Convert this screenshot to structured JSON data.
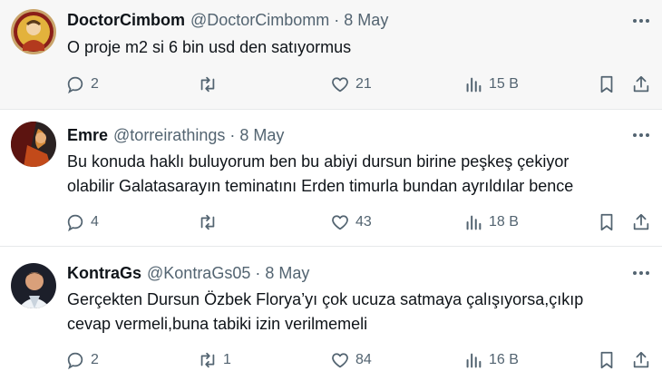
{
  "tweets": [
    {
      "name": "DoctorCimbom",
      "handle": "@DoctorCimbomm",
      "separator": "·",
      "date": "8 May",
      "text_lines": [
        "O proje m2 si 6 bin usd den satıyormus"
      ],
      "replies": "2",
      "retweets": "",
      "likes": "21",
      "views": "15 B"
    },
    {
      "name": "Emre",
      "handle": "@torreirathings",
      "separator": "·",
      "date": "8 May",
      "text_lines": [
        "Bu konuda haklı buluyorum ben bu abiyi dursun birine peşkeş çekiyor",
        "olabilir Galatasarayın teminatını Erden timurla bundan ayrıldılar bence"
      ],
      "replies": "4",
      "retweets": "",
      "likes": "43",
      "views": "18 B"
    },
    {
      "name": "KontraGs",
      "handle": "@KontraGs05",
      "separator": "·",
      "date": "8 May",
      "text_lines": [
        "Gerçekten Dursun Özbek Florya’yı çok ucuza satmaya çalışıyorsa,çıkıp",
        "cevap vermeli,buna tabiki izin verilmemeli"
      ],
      "replies": "2",
      "retweets": "1",
      "likes": "84",
      "views": "16 B"
    }
  ],
  "icons": {
    "avatar": "avatar",
    "more": "more-icon",
    "reply": "reply-icon",
    "retweet": "retweet-icon",
    "like": "like-icon",
    "views": "views-icon",
    "bookmark": "bookmark-icon",
    "share": "share-icon"
  },
  "colors": {
    "text": "#0f1419",
    "secondary": "#536471",
    "highlight_row": "#f7f7f7",
    "divider": "#e7e9ea"
  }
}
